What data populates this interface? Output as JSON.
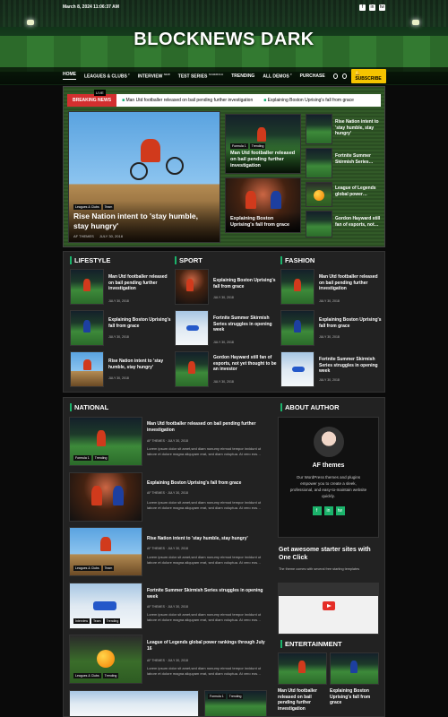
{
  "topbar": {
    "date": "March 8, 2024 11:06:37 AM",
    "socials": [
      "f",
      "in",
      "tw"
    ]
  },
  "site": {
    "title": "BLOCKNEWS DARK"
  },
  "nav": {
    "items": [
      {
        "label": "HOME",
        "sup": ""
      },
      {
        "label": "LEAGUES & CLUBS",
        "sup": "▾"
      },
      {
        "label": "INTERVIEW",
        "sup": "NEW"
      },
      {
        "label": "TEST SERIES",
        "sup": "SCHEDULE"
      },
      {
        "label": "TRENDING",
        "sup": ""
      },
      {
        "label": "ALL DEMOS",
        "sup": "▾"
      },
      {
        "label": "PURCHASE",
        "sup": ""
      }
    ],
    "subscribe": "SUBSCRIBE"
  },
  "ticker": {
    "live": "LIVE",
    "label": "BREAKING NEWS",
    "items": [
      "Man Utd footballer released on bail pending further investigation",
      "Explaining Boston Uprising's fall from grace"
    ]
  },
  "hero": {
    "main": {
      "tags": [
        "Leagues & Clubs",
        "Team"
      ],
      "title": "Rise Nation intent to 'stay humble, stay hungry'",
      "author": "AF THEMES",
      "date": "JULY 30, 2018"
    },
    "mid": [
      {
        "tags": [
          "Formula 1",
          "Trending"
        ],
        "title": "Man Utd footballer released on bail pending further investigation"
      },
      {
        "tags": [],
        "title": "Explaining Boston Uprising's fall from grace"
      }
    ],
    "side": [
      "Rise Nation intent to 'stay humble, stay hungry'",
      "Fortnite Summer Skirmish Series…",
      "League of Legends global power…",
      "Gordon Hayward still fan of esports, not…"
    ]
  },
  "cats": {
    "lifestyle": {
      "title": "LIFESTYLE",
      "items": [
        {
          "title": "Man Utd footballer released on bail pending further investigation",
          "date": "JULY 30, 2018"
        },
        {
          "title": "Explaining Boston Uprising's fall from grace",
          "date": "JULY 30, 2018"
        },
        {
          "title": "Rise Nation intent to 'stay humble, stay hungry'",
          "date": "JULY 30, 2018"
        }
      ]
    },
    "sport": {
      "title": "SPORT",
      "items": [
        {
          "title": "Explaining Boston Uprising's fall from grace",
          "date": "JULY 30, 2018"
        },
        {
          "title": "Fortnite Summer Skirmish Series struggles in opening week",
          "date": "JULY 30, 2018"
        },
        {
          "title": "Gordon Hayward still fan of esports, not yet thought to be an investor",
          "date": "JULY 30, 2018"
        }
      ]
    },
    "fashion": {
      "title": "FASHION",
      "items": [
        {
          "title": "Man Utd footballer released on bail pending further investigation",
          "date": "JULY 30, 2018"
        },
        {
          "title": "Explaining Boston Uprising's fall from grace",
          "date": "JULY 30, 2018"
        },
        {
          "title": "Fortnite Summer Skirmish Series struggles in opening week",
          "date": "JULY 30, 2018"
        }
      ]
    }
  },
  "national": {
    "title": "NATIONAL",
    "excerpt": "Lorem ipsum dolor sit amet,sed diam nonumy eirmod tempor invidunt ut labore et dolore magna aliquyam erat, sed diam voluptua. At vero eos…",
    "items": [
      {
        "tags": [
          "Formula 1",
          "Trending"
        ],
        "title": "Man Utd footballer released on bail pending further investigation",
        "author": "AF THEMES",
        "date": "JULY 30, 2018"
      },
      {
        "tags": [],
        "title": "Explaining Boston Uprising's fall from grace",
        "author": "AF THEMES",
        "date": "JULY 30, 2018"
      },
      {
        "tags": [
          "Leagues & Clubs",
          "Team"
        ],
        "title": "Rise Nation intent to 'stay humble, stay hungry'",
        "author": "AF THEMES",
        "date": "JULY 30, 2018"
      },
      {
        "tags": [
          "Interview",
          "Team",
          "Trending"
        ],
        "title": "Fortnite Summer Skirmish Series struggles in opening week",
        "author": "AF THEMES",
        "date": "JULY 30, 2018"
      },
      {
        "tags": [
          "Leagues & Clubs",
          "Trending"
        ],
        "title": "League of Legends global power rankings through July 16",
        "author": "AF THEMES",
        "date": "JULY 30, 2018"
      }
    ],
    "bottom_tags": [
      "Formula 1",
      "Trending"
    ]
  },
  "author": {
    "title": "ABOUT AUTHOR",
    "name": "AF themes",
    "desc": "Our WordPress themes and plugins empower you to create a sleek, professional, and easy-to-maintain website quickly.",
    "socials": [
      "f",
      "in",
      "tw"
    ]
  },
  "starter": {
    "title": "Get awesome starter sites with One Click",
    "sub": "The theme comes with several free starting templates"
  },
  "entertainment": {
    "title": "ENTERTAINMENT",
    "items": [
      "Man Utd footballer released on bail pending further investigation",
      "Explaining Boston Uprising's fall from grace"
    ]
  },
  "colors": {
    "accent": "#1bb36b",
    "breaking": "#d32f2f",
    "subscribe": "#f5c400"
  }
}
